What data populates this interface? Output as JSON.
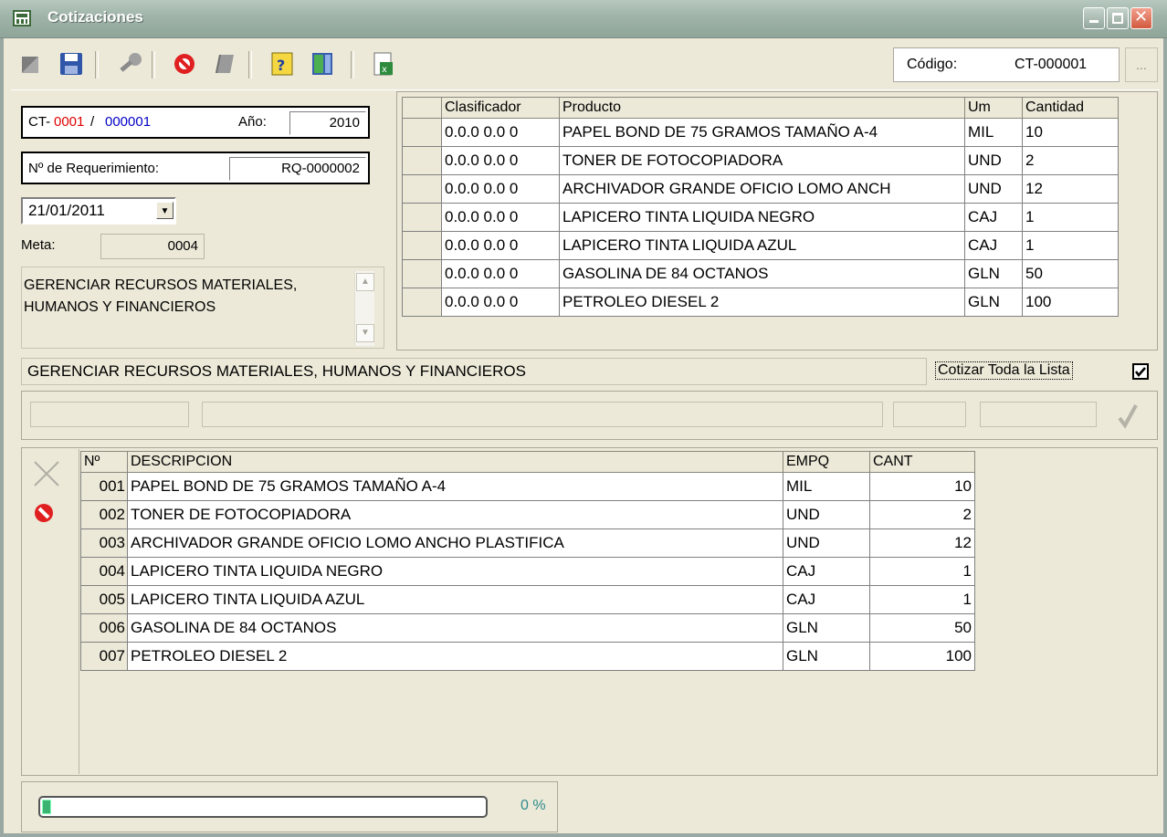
{
  "window": {
    "title": "Cotizaciones"
  },
  "toolbar": {
    "buttons": [
      "new-icon",
      "save-icon",
      "search-icon",
      "cancel-icon",
      "edit-icon",
      "help-icon",
      "exit-icon",
      "excel-icon"
    ],
    "codigo_label": "Código:",
    "codigo_value": "CT-000001",
    "lookup_label": "..."
  },
  "header": {
    "ct_prefix": "CT-",
    "ct_num": "0001",
    "ct_slash": "/",
    "ct_code": "000001",
    "anio_label": "Año:",
    "anio_value": "2010",
    "req_label": "Nº de Requerimiento:",
    "req_value": "RQ-0000002",
    "fecha": "21/01/2011",
    "meta_label": "Meta:",
    "meta_value": "0004",
    "meta_desc": "GERENCIAR RECURSOS MATERIALES, HUMANOS Y FINANCIEROS",
    "desc_full": "GERENCIAR RECURSOS MATERIALES, HUMANOS Y FINANCIEROS",
    "cotizar_label": "Cotizar Toda la Lista",
    "cotizar_checked": true
  },
  "req_grid": {
    "columns": [
      "Clasificador",
      "Producto",
      "Um",
      "Cantidad"
    ],
    "rows": [
      [
        "0.0.0 0.0 0",
        "PAPEL BOND DE 75 GRAMOS TAMAÑO A-4",
        "MIL",
        "10"
      ],
      [
        "0.0.0 0.0 0",
        "TONER DE FOTOCOPIADORA",
        "UND",
        "2"
      ],
      [
        "0.0.0 0.0 0",
        "ARCHIVADOR GRANDE OFICIO LOMO ANCH",
        "UND",
        "12"
      ],
      [
        "0.0.0 0.0 0",
        "LAPICERO TINTA LIQUIDA NEGRO",
        "CAJ",
        "1"
      ],
      [
        "0.0.0 0.0 0",
        "LAPICERO TINTA LIQUIDA AZUL",
        "CAJ",
        "1"
      ],
      [
        "0.0.0 0.0 0",
        "GASOLINA DE 84 OCTANOS",
        "GLN",
        "50"
      ],
      [
        "0.0.0 0.0 0",
        "PETROLEO DIESEL 2",
        "GLN",
        "100"
      ]
    ]
  },
  "quote_grid": {
    "columns": [
      "Nº",
      "DESCRIPCION",
      "EMPQ",
      "CANT"
    ],
    "rows": [
      [
        "001",
        "PAPEL BOND DE 75 GRAMOS TAMAÑO A-4",
        "MIL",
        "10"
      ],
      [
        "002",
        "TONER DE FOTOCOPIADORA",
        "UND",
        "2"
      ],
      [
        "003",
        "ARCHIVADOR GRANDE OFICIO LOMO ANCHO PLASTIFICA",
        "UND",
        "12"
      ],
      [
        "004",
        "LAPICERO TINTA LIQUIDA NEGRO",
        "CAJ",
        "1"
      ],
      [
        "005",
        "LAPICERO TINTA LIQUIDA AZUL",
        "CAJ",
        "1"
      ],
      [
        "006",
        "GASOLINA DE 84 OCTANOS",
        "GLN",
        "50"
      ],
      [
        "007",
        "PETROLEO DIESEL 2",
        "GLN",
        "100"
      ]
    ]
  },
  "progress": {
    "text": "0 %",
    "value": 0.02
  },
  "colors": {
    "ct_num": "#E00000",
    "ct_code": "#0000C8",
    "progress_text": "#2E8B8B",
    "progress_fill": "#3CB371"
  }
}
